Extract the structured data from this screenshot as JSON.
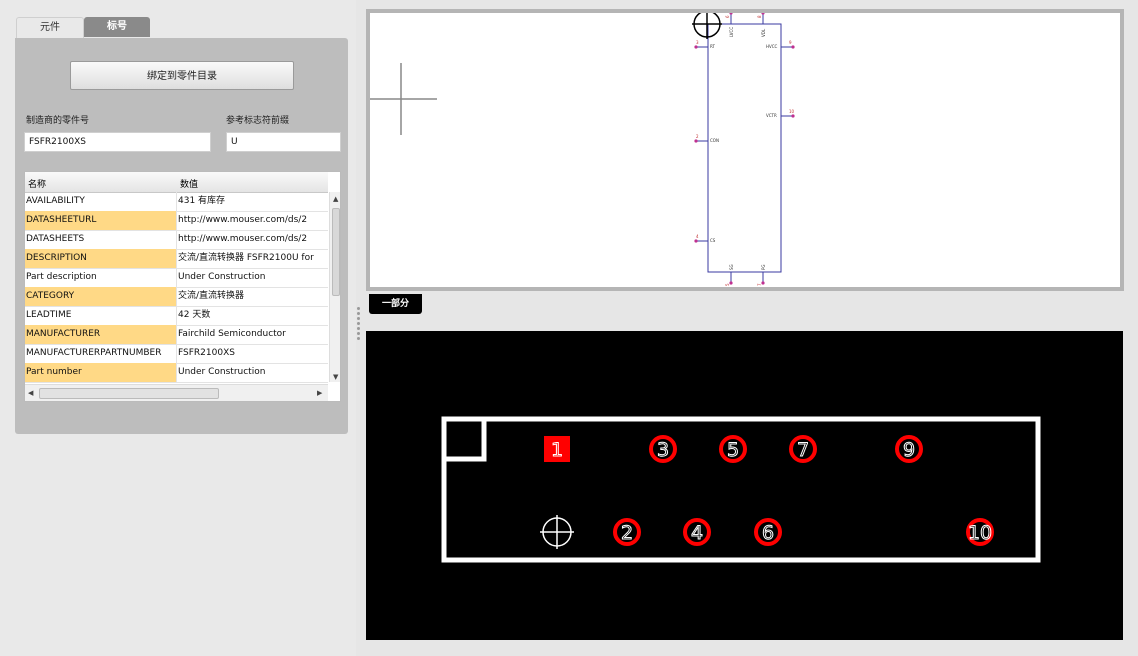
{
  "tabs": {
    "components": "元件",
    "labels": "标号"
  },
  "bind_button": "绑定到零件目录",
  "fields": {
    "mfr_part_label": "制造商的零件号",
    "mfr_part_value": "FSFR2100XS",
    "refdes_label": "参考标志符前缀",
    "refdes_value": "U"
  },
  "grid": {
    "col_name": "名称",
    "col_value": "数值",
    "rows": [
      {
        "name": "AVAILABILITY",
        "value": "431 有库存",
        "hl": false
      },
      {
        "name": "DATASHEETURL",
        "value": "http://www.mouser.com/ds/2",
        "hl": true
      },
      {
        "name": "DATASHEETS",
        "value": "http://www.mouser.com/ds/2",
        "hl": false
      },
      {
        "name": "DESCRIPTION",
        "value": "交流/直流转换器 FSFR2100U for",
        "hl": true
      },
      {
        "name": "Part description",
        "value": "Under Construction",
        "hl": false
      },
      {
        "name": "CATEGORY",
        "value": "交流/直流转换器",
        "hl": true
      },
      {
        "name": "LEADTIME",
        "value": "42 天数",
        "hl": false
      },
      {
        "name": "MANUFACTURER",
        "value": "Fairchild Semiconductor",
        "hl": true
      },
      {
        "name": "MANUFACTURERPARTNUMBER",
        "value": "FSFR2100XS",
        "hl": false
      },
      {
        "name": "Part number",
        "value": "Under Construction",
        "hl": true
      }
    ]
  },
  "section_badge": "一部分",
  "schematic": {
    "pins_left": [
      {
        "num": "3",
        "label": "RT"
      },
      {
        "num": "2",
        "label": "CON"
      },
      {
        "num": "4",
        "label": "CS"
      }
    ],
    "pins_right": [
      {
        "num": "9",
        "label": "HVCC"
      },
      {
        "num": "10",
        "label": "VCTR"
      }
    ],
    "pins_top": [
      {
        "num": "6",
        "label": "LVCC"
      },
      {
        "num": "8",
        "label": "VDL"
      }
    ],
    "pins_bottom": [
      {
        "num": "5",
        "label": "SG"
      },
      {
        "num": "7",
        "label": "PG"
      }
    ]
  },
  "pcb": {
    "pads": [
      "1",
      "2",
      "3",
      "4",
      "5",
      "6",
      "7",
      "9",
      "10"
    ]
  },
  "colors": {
    "highlight": "#ffd986",
    "pad": "#ff0000",
    "schematic_line": "#3a3aa0"
  }
}
